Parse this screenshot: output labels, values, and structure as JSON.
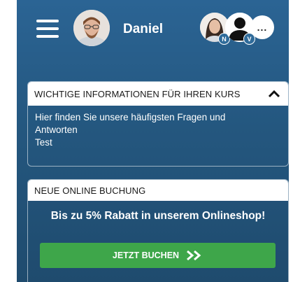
{
  "header": {
    "user_name": "Daniel",
    "participants": [
      {
        "badge": "N"
      },
      {
        "badge": "V"
      }
    ],
    "more_label": "..."
  },
  "info_card": {
    "title": "WICHTIGE INFORMATIONEN FÜR IHREN KURS",
    "lines": [
      "Hier finden Sie unsere häufigsten Fragen und",
      "Antworten",
      "Test"
    ]
  },
  "booking_card": {
    "title": "NEUE ONLINE BUCHUNG",
    "promo": "Bis zu 5% Rabatt in unserem Onlineshop!",
    "cta_label": "JETZT BUCHEN"
  },
  "colors": {
    "background": "#24577f",
    "cta": "#3ea64a",
    "badge": "#2f6b9a"
  }
}
